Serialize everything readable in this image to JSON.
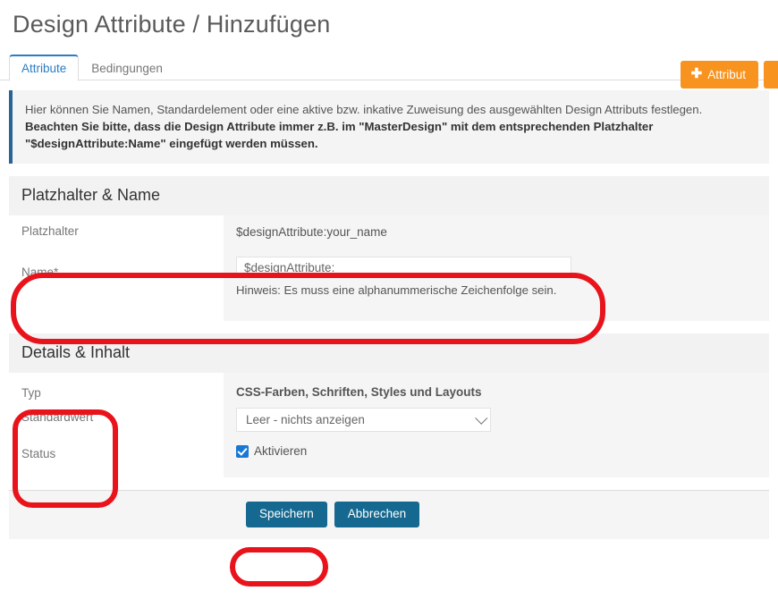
{
  "page": {
    "title": "Design Attribute / Hinzufügen"
  },
  "tabs": [
    {
      "label": "Attribute",
      "active": true
    },
    {
      "label": "Bedingungen",
      "active": false
    }
  ],
  "top_actions": {
    "add_attribute_label": "Attribut",
    "plus_glyph": "✚",
    "partial_button_label": ""
  },
  "banner": {
    "line1": "Hier können Sie Namen, Standardelement oder eine aktive bzw. inkative Zuweisung des ausgewählten Design Attributs festlegen.",
    "line2": "Beachten Sie bitte, dass die Design Attribute immer z.B. im \"MasterDesign\" mit dem entsprechenden Platzhalter",
    "line3": "\"$designAttribute:Name\" eingefügt werden müssen.",
    "accent_color": "#2a6496"
  },
  "sections": {
    "placeholder_name": {
      "header": "Platzhalter & Name",
      "rows": {
        "placeholder": {
          "label": "Platzhalter",
          "value": "$designAttribute:your_name"
        },
        "name": {
          "label": "Name*",
          "input_value": "$designAttribute:",
          "input_placeholder": "$designAttribute:",
          "hint": "Hinweis: Es muss eine alphanummerische Zeichenfolge sein."
        }
      }
    },
    "details_content": {
      "header": "Details & Inhalt",
      "labels": {
        "typ": "Typ",
        "standardwert": "Standardwert",
        "status": "Status"
      },
      "field_group_title": "CSS-Farben, Schriften, Styles und Layouts",
      "select": {
        "selected": "Leer - nichts anzeigen",
        "caret_icon": "chevron-down-icon"
      },
      "checkbox": {
        "label": "Aktivieren",
        "checked": true,
        "color": "#1878d4"
      }
    }
  },
  "footer": {
    "save_label": "Speichern",
    "cancel_label": "Abbrechen",
    "button_color": "#15688f"
  },
  "annotations": {
    "color": "#e8131b",
    "shapes": [
      {
        "name": "name-field-highlight"
      },
      {
        "name": "details-labels-highlight"
      },
      {
        "name": "save-button-highlight"
      }
    ]
  }
}
